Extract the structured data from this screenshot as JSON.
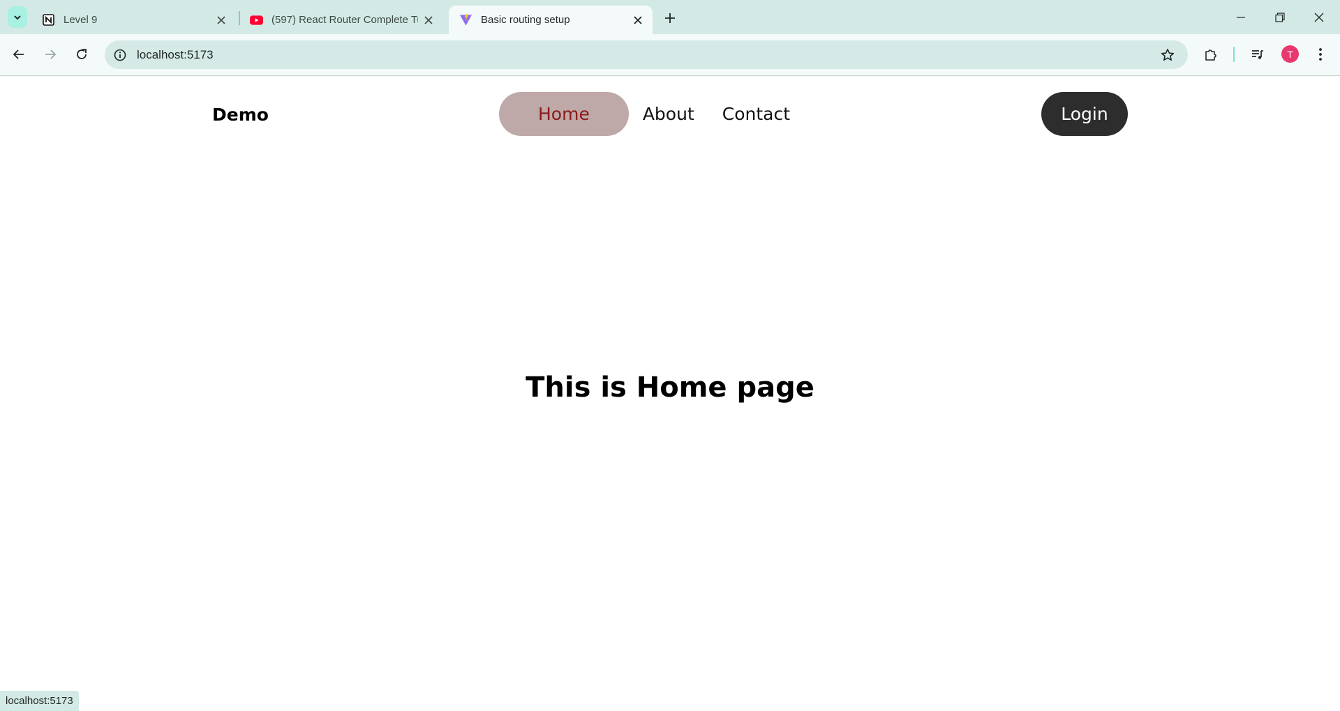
{
  "browser": {
    "tabs": [
      {
        "title": "Level 9",
        "favicon": "notion-icon"
      },
      {
        "title": "(597) React Router Complete Tu",
        "favicon": "youtube-icon"
      },
      {
        "title": "Basic routing setup",
        "favicon": "vite-icon"
      }
    ],
    "active_tab_index": 2,
    "url": "localhost:5173",
    "profile_initial": "T",
    "accent_color": "#d3e9e5"
  },
  "site": {
    "brand": "Demo",
    "nav": [
      {
        "label": "Home"
      },
      {
        "label": "About"
      },
      {
        "label": "Contact"
      }
    ],
    "active_nav_index": 0,
    "login_label": "Login",
    "heading": "This is Home page",
    "colors": {
      "active_pill_bg": "#bfa8a8",
      "active_pill_text": "#8b1a1a",
      "login_bg": "#2d2d2d"
    }
  },
  "status_bar": {
    "text": "localhost:5173"
  }
}
